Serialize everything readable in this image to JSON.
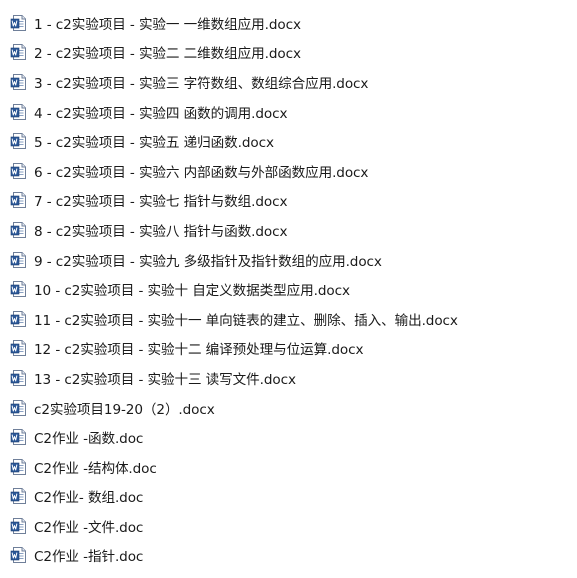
{
  "files": [
    {
      "name": "1 - c2实验项目 - 实验一 一维数组应用.docx",
      "icon": "word-document-icon"
    },
    {
      "name": "2 - c2实验项目 - 实验二 二维数组应用.docx",
      "icon": "word-document-icon"
    },
    {
      "name": "3 - c2实验项目 - 实验三 字符数组、数组综合应用.docx",
      "icon": "word-document-icon"
    },
    {
      "name": "4 - c2实验项目 - 实验四 函数的调用.docx",
      "icon": "word-document-icon"
    },
    {
      "name": "5 - c2实验项目 - 实验五 递归函数.docx",
      "icon": "word-document-icon"
    },
    {
      "name": "6 - c2实验项目 - 实验六 内部函数与外部函数应用.docx",
      "icon": "word-document-icon"
    },
    {
      "name": "7 - c2实验项目 - 实验七 指针与数组.docx",
      "icon": "word-document-icon"
    },
    {
      "name": "8 - c2实验项目 - 实验八 指针与函数.docx",
      "icon": "word-document-icon"
    },
    {
      "name": "9 - c2实验项目 - 实验九 多级指针及指针数组的应用.docx",
      "icon": "word-document-icon"
    },
    {
      "name": "10 - c2实验项目 - 实验十 自定义数据类型应用.docx",
      "icon": "word-document-icon"
    },
    {
      "name": "11 - c2实验项目 - 实验十一 单向链表的建立、删除、插入、输出.docx",
      "icon": "word-document-icon"
    },
    {
      "name": "12 - c2实验项目 - 实验十二 编译预处理与位运算.docx",
      "icon": "word-document-icon"
    },
    {
      "name": "13 - c2实验项目 - 实验十三 读写文件.docx",
      "icon": "word-document-icon"
    },
    {
      "name": "c2实验项目19-20（2）.docx",
      "icon": "word-document-icon"
    },
    {
      "name": "C2作业 -函数.doc",
      "icon": "word-document-icon"
    },
    {
      "name": "C2作业 -结构体.doc",
      "icon": "word-document-icon"
    },
    {
      "name": "C2作业- 数组.doc",
      "icon": "word-document-icon"
    },
    {
      "name": "C2作业 -文件.doc",
      "icon": "word-document-icon"
    },
    {
      "name": "C2作业 -指针.doc",
      "icon": "word-document-icon"
    }
  ],
  "colors": {
    "icon_blue": "#2b5797",
    "icon_paper": "#ffffff",
    "text": "#1a1a1a"
  }
}
